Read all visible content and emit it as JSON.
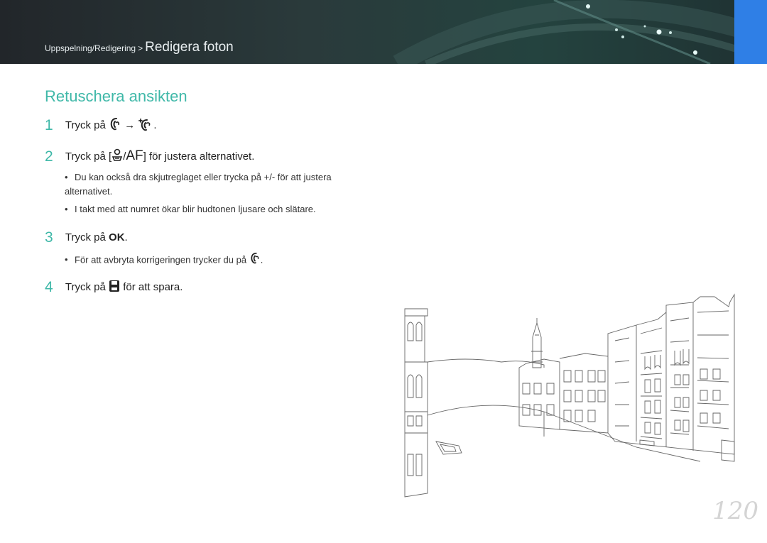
{
  "header": {
    "breadcrumb_parent": "Uppspelning/Redigering",
    "breadcrumb_separator": ">",
    "breadcrumb_current": "Redigera foton",
    "accent_color": "#2f7fe6"
  },
  "section": {
    "title": "Retuschera ansikten",
    "color": "#3fb8a8"
  },
  "steps": [
    {
      "num": "1",
      "text_a": "Tryck på",
      "arrow": "→",
      "text_b": ".",
      "icons": [
        "face-icon",
        "face-retouch-icon"
      ]
    },
    {
      "num": "2",
      "text_a": "Tryck på [",
      "slash": "/",
      "af": "AF",
      "text_b": "] för justera alternativet.",
      "icons": [
        "focus-icon"
      ],
      "bullets": [
        "Du kan också dra skjutreglaget eller trycka på +/- för att justera alternativet.",
        "I takt med att numret ökar blir hudtonen ljusare och slätare."
      ]
    },
    {
      "num": "3",
      "text_a": "Tryck på",
      "ok": "OK",
      "text_b": ".",
      "bullets": [
        "För att avbryta korrigeringen trycker du på"
      ],
      "bullet_end": "."
    },
    {
      "num": "4",
      "text_a": "Tryck på",
      "text_b": "för att spara.",
      "icons": [
        "save-icon"
      ]
    }
  ],
  "bullet_symbol": "•",
  "illustration": {
    "icon": "venice-canal-sketch-icon"
  },
  "page_number": "120"
}
